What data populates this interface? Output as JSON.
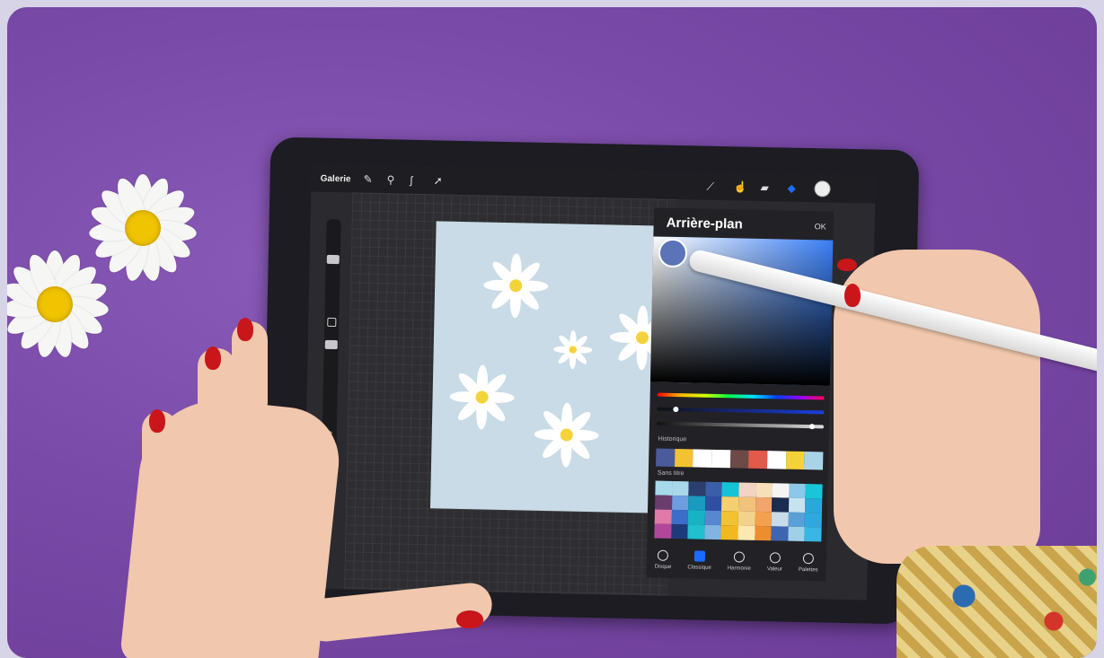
{
  "app": {
    "gallery_label": "Galerie",
    "toolbar_icons": [
      "wrench-icon",
      "magic-wand-icon",
      "selection-icon",
      "transform-icon"
    ],
    "right_tools": [
      "brush-icon",
      "smudge-icon",
      "eraser-icon",
      "layers-icon",
      "color-icon"
    ]
  },
  "color_panel": {
    "title": "Arrière-plan",
    "ok_label": "OK",
    "history_label": "Historique",
    "palette_label": "Sans titre",
    "history_colors": [
      "#4a5a9a",
      "#f2c230",
      "#ffffff",
      "#ffffff",
      "#6d4a48",
      "#e25a4a",
      "#ffffff",
      "#f4d33a",
      "#a9d4e8"
    ],
    "palette_colors": [
      "#a9d8ea",
      "#a9d8ea",
      "#2c3e6e",
      "#3b5ea8",
      "#14c4d6",
      "#f3d3c2",
      "#f6e0b9",
      "#f4f4f4",
      "#8cc8ea",
      "#19c6d8",
      "#6a3d6e",
      "#6e9de0",
      "#1a9abf",
      "#2f4fa0",
      "#f4d070",
      "#f3c27a",
      "#f1a56c",
      "#1b2c52",
      "#c7e3f0",
      "#2aa9d9",
      "#e07aa8",
      "#3a6ec8",
      "#17b2c4",
      "#5887d0",
      "#f2c230",
      "#f3d38c",
      "#f4a14e",
      "#c7dbe8",
      "#5aa0d8",
      "#2fa8e0",
      "#b1479a",
      "#1e3a7a",
      "#20c0cf",
      "#7fb5e0",
      "#f1b822",
      "#fde9b0",
      "#ee8c30",
      "#3e66b0",
      "#9fd0e8",
      "#38b6e6"
    ],
    "tabs": [
      "Disque",
      "Classique",
      "Harmonie",
      "Valeur",
      "Palettes"
    ],
    "active_tab": "Classique",
    "current_color": "#5b74b7"
  }
}
